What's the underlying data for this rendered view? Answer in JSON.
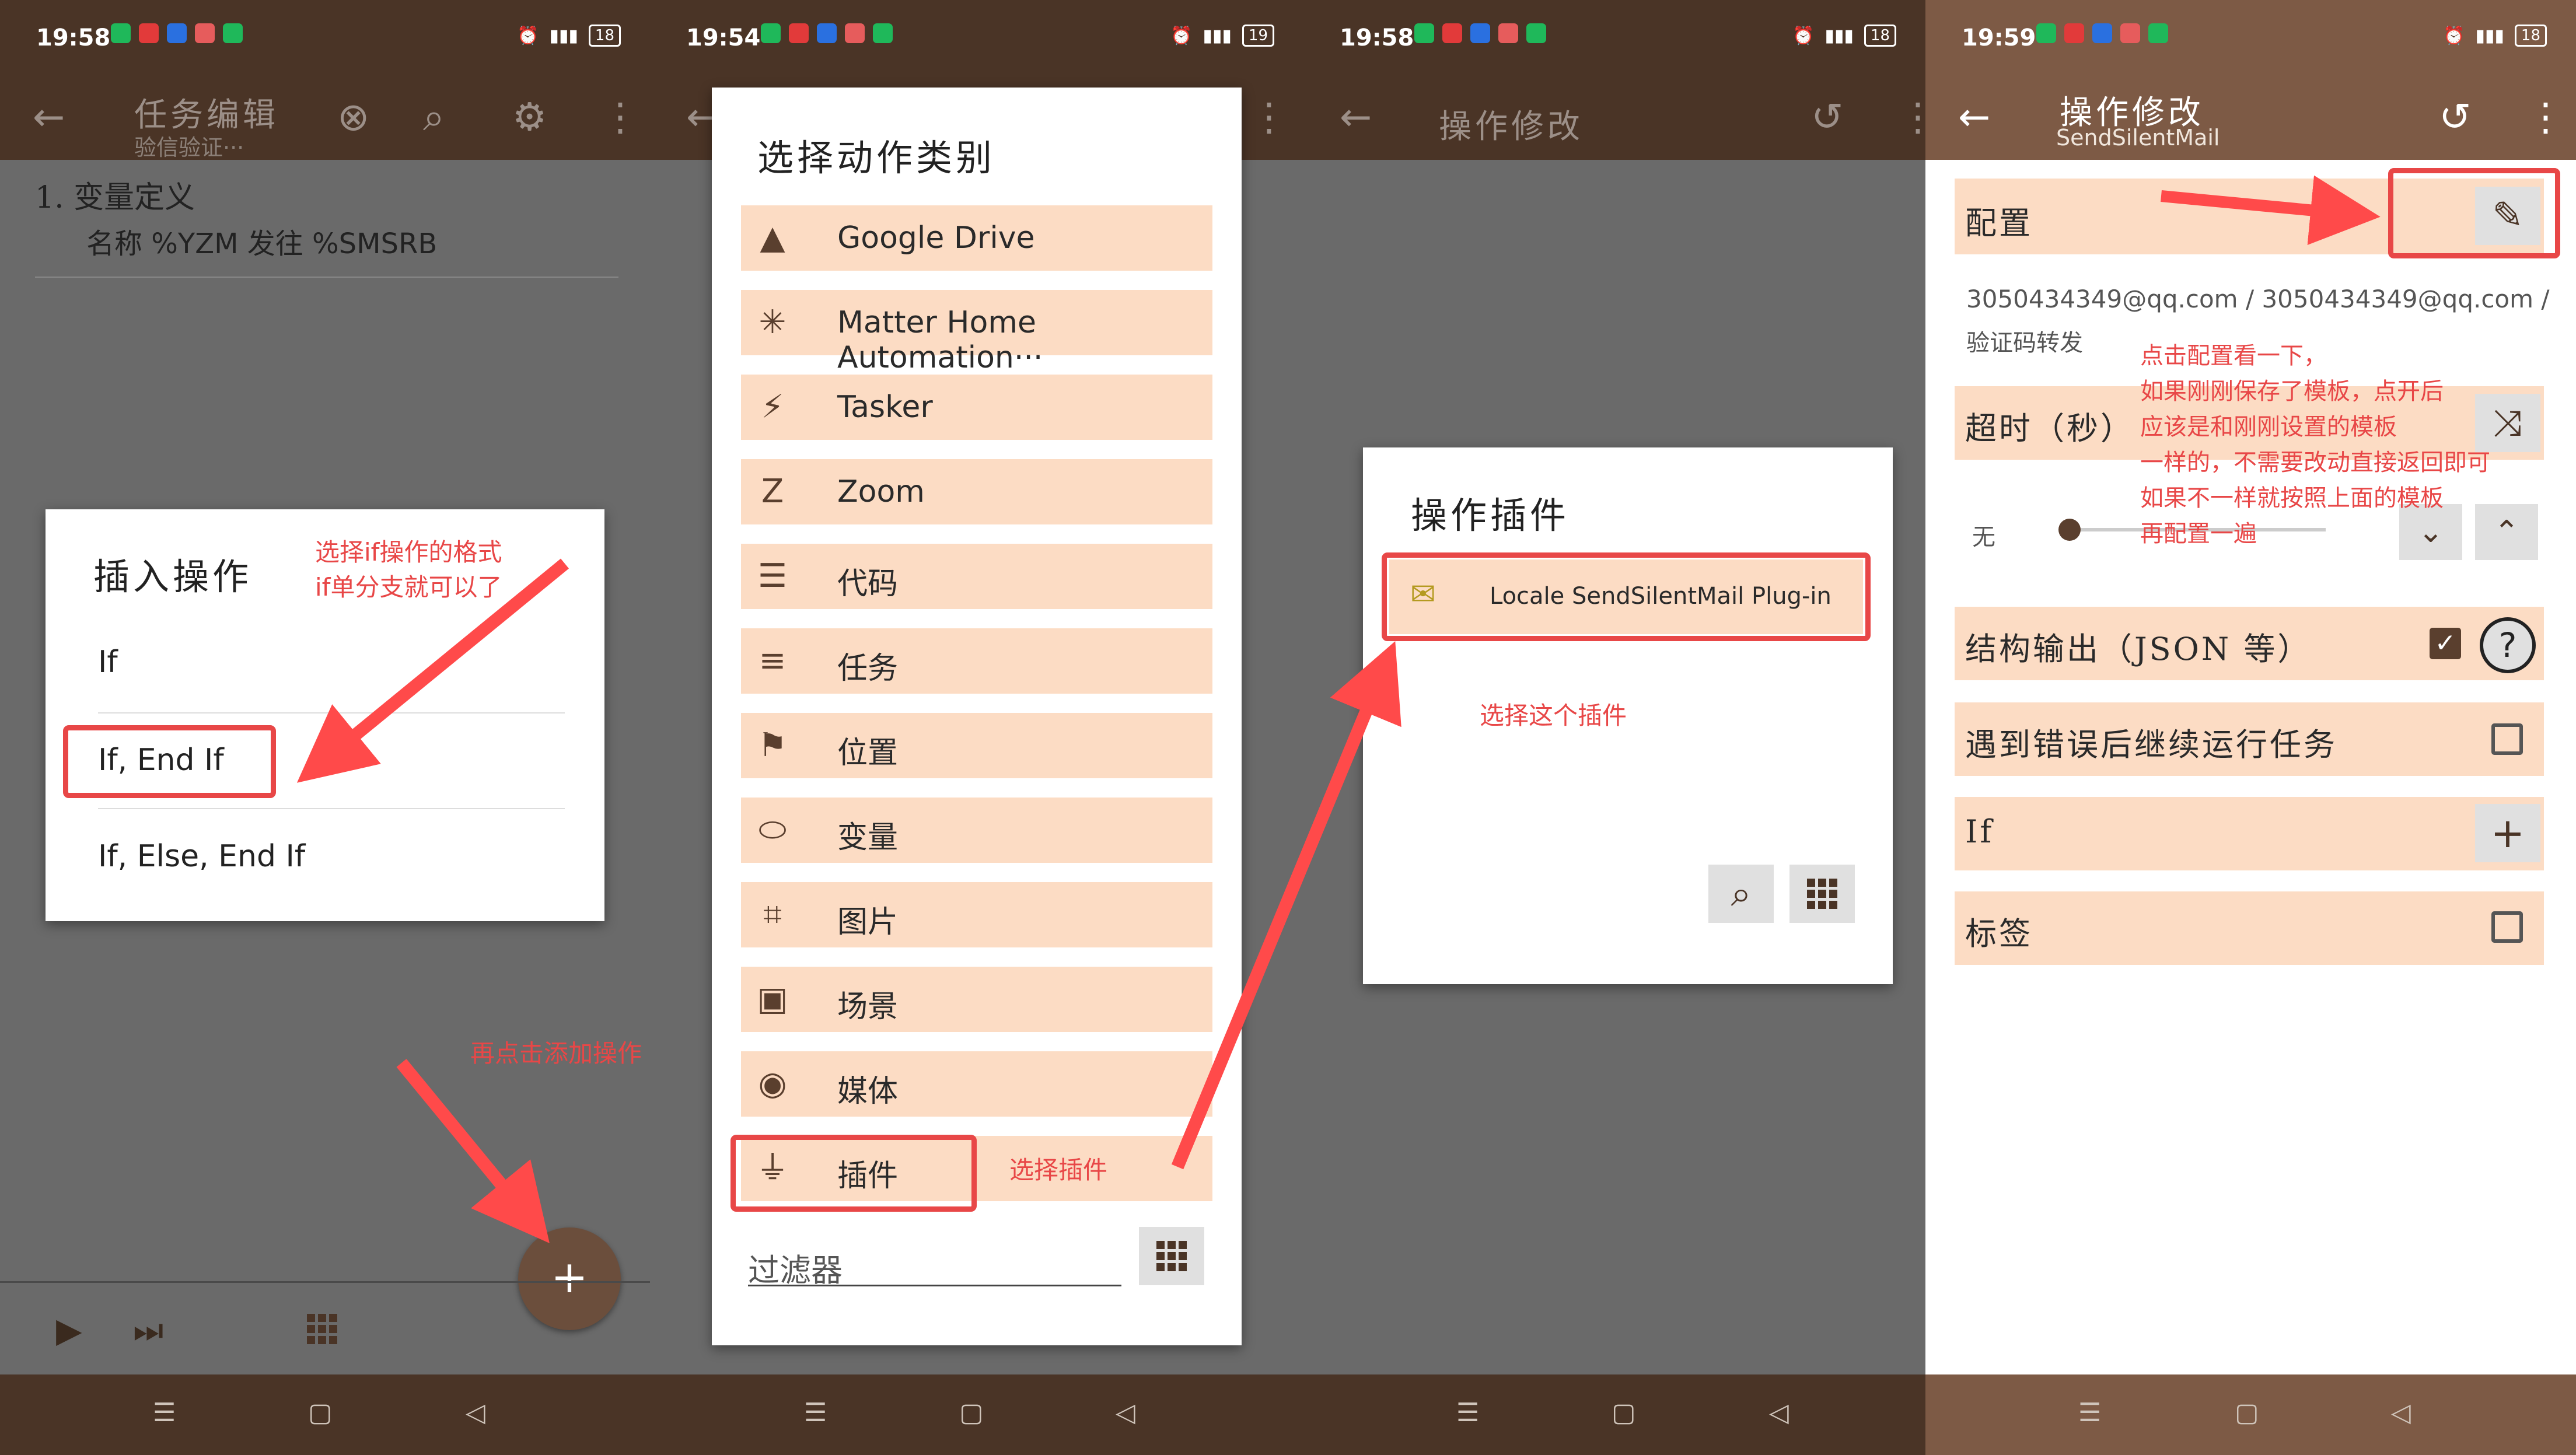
{
  "p1": {
    "status_time": "19:58",
    "battery": "18",
    "toolbar_title": "任务编辑",
    "toolbar_subtitle": "验信验证···",
    "list_item_title": "1.  变量定义",
    "list_item_detail": "名称 %YZM 发往 %SMSRB",
    "dialog_title": "插入操作",
    "options": [
      "If",
      "If, End If",
      "If, Else, End If"
    ],
    "annot_if": "选择if操作的格式\nif单分支就可以了",
    "annot_add": "再点击添加操作",
    "fab_label": "+"
  },
  "p2": {
    "status_time": "19:54",
    "battery": "19",
    "dialog_title": "选择动作类别",
    "categories": [
      {
        "label": "Google Drive",
        "icon": "▲"
      },
      {
        "label": "Matter Home Automation···",
        "icon": "✳"
      },
      {
        "label": "Tasker",
        "icon": "⚡"
      },
      {
        "label": "Zoom",
        "icon": "Z"
      },
      {
        "label": "代码",
        "icon": "☰"
      },
      {
        "label": "任务",
        "icon": "≡"
      },
      {
        "label": "位置",
        "icon": "⚑"
      },
      {
        "label": "变量",
        "icon": "⬭"
      },
      {
        "label": "图片",
        "icon": "⌗"
      },
      {
        "label": "场景",
        "icon": "▣"
      },
      {
        "label": "媒体",
        "icon": "◉"
      },
      {
        "label": "插件",
        "icon": "⏚"
      }
    ],
    "annot_plugin": "选择插件",
    "filter_placeholder": "过滤器"
  },
  "p3": {
    "status_time": "19:58",
    "battery": "18",
    "toolbar_title": "操作修改",
    "dialog_title": "操作插件",
    "plugin_label": "Locale SendSilentMail Plug-in",
    "annot_select": "选择这个插件"
  },
  "p4": {
    "status_time": "19:59",
    "battery": "18",
    "toolbar_title": "操作修改",
    "toolbar_subtitle": "SendSilentMail",
    "config_label": "配置",
    "config_value": "3050434349@qq.com / 3050434349@qq.com /",
    "config_value2": "验证码转发",
    "annot_config": "点击配置看一下，\n如果刚刚保存了模板，点开后\n应该是和刚刚设置的模板\n一样的，不需要改动直接返回即可\n如果不一样就按照上面的模板\n再配置一遍",
    "timeout_label": "超时（秒）",
    "slider_value": "无",
    "structured_label": "结构输出（JSON 等）",
    "continue_label": "遇到错误后继续运行任务",
    "if_label": "If",
    "tag_label": "标签"
  },
  "colors": {
    "bar": "#4a3426",
    "item_bg": "#fcdcc4",
    "annotation": "#e84747"
  }
}
